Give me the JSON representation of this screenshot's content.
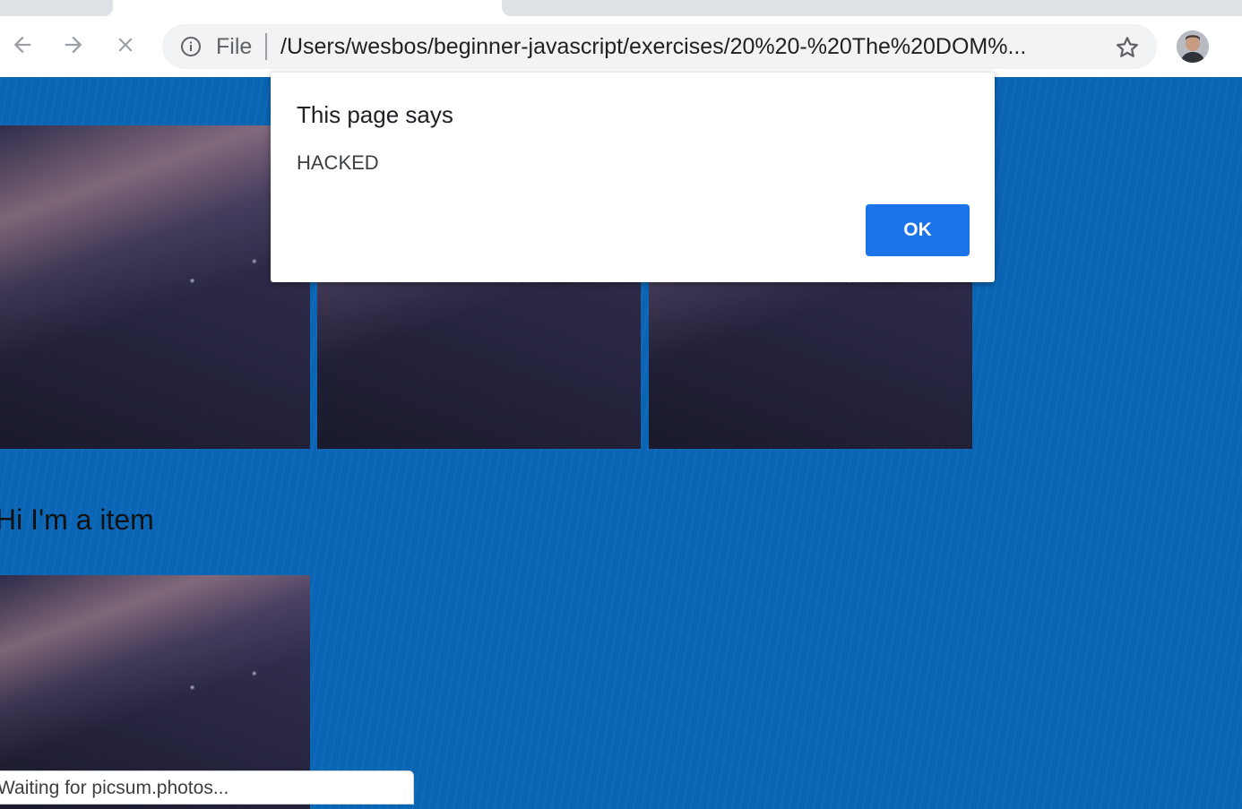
{
  "toolbar": {
    "back_icon": "arrow-left-icon",
    "forward_icon": "arrow-right-icon",
    "stop_icon": "close-icon",
    "info_icon": "info-icon",
    "bookmark_icon": "star-icon"
  },
  "omnibox": {
    "scheme": "File",
    "url": "/Users/wesbos/beginner-javascript/exercises/20%20-%20The%20DOM%..."
  },
  "page": {
    "heading": "Hi I'm a item"
  },
  "dialog": {
    "title": "This page says",
    "message": "HACKED",
    "ok_label": "OK"
  },
  "status": {
    "text": "Waiting for picsum.photos..."
  },
  "colors": {
    "page_background": "#0a65b5",
    "primary_button": "#1a73e8"
  }
}
